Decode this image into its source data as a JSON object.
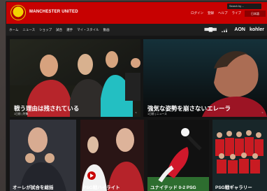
{
  "header": {
    "brand": "MANCHESTER UNITED",
    "links": [
      "ログイン",
      "登録",
      "ヘルプ",
      "ライブ"
    ],
    "search_placeholder": "Search by ...",
    "language_label": "日本語"
  },
  "nav": {
    "items": [
      "ホーム",
      "ニュース",
      "ショップ",
      "試合",
      "選手",
      "マイ・スタイル",
      "動画"
    ],
    "partners": [
      "Chevrolet",
      "adidas",
      "AON",
      "kohler"
    ]
  },
  "cards": {
    "hero_left": {
      "title": "戦う理由は残されている",
      "meta": "1日前 | 特集"
    },
    "hero_right": {
      "title": "強気な姿勢を崩さないエレーラ",
      "meta": "1日前 | ニュース"
    },
    "small_1": {
      "title": "オーレが試合を総括"
    },
    "small_2": {
      "title": "PSG戦ハイライト"
    },
    "small_3": {
      "title": "ユナイテッド 0-2 PSG"
    },
    "small_4": {
      "title": "PSG戦ギャラリー"
    }
  },
  "colors": {
    "brand_red": "#c70101",
    "nav_bg": "#1e1e1e",
    "page_bg": "#151515"
  }
}
